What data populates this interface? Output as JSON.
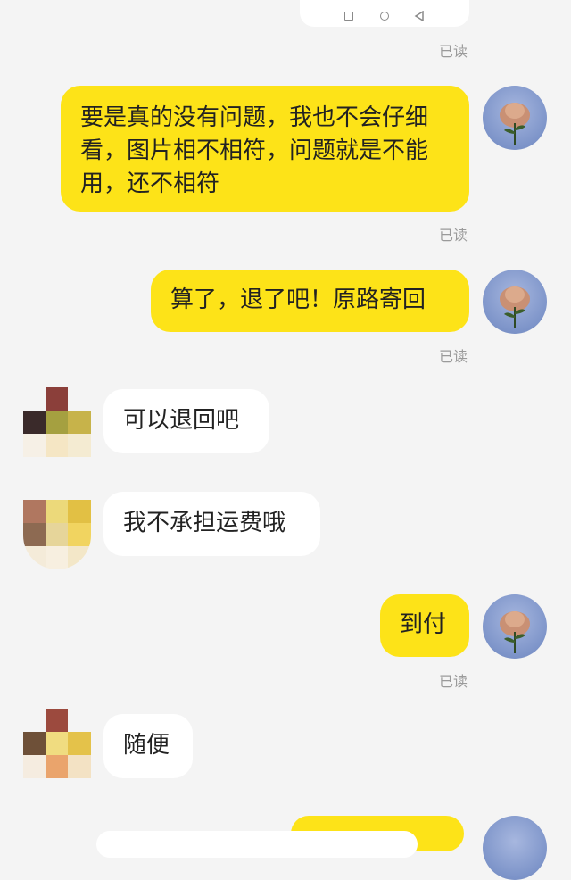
{
  "read_label": "已读",
  "messages": [
    {
      "from": "me",
      "text": "要是真的没有问题，我也不会仔细看，图片相不相符，问题就是不能用，还不相符"
    },
    {
      "from": "me",
      "text": "算了，退了吧！原路寄回"
    },
    {
      "from": "them",
      "text": "可以退回吧"
    },
    {
      "from": "them",
      "text": "我不承担运费哦"
    },
    {
      "from": "me",
      "text": "到付"
    },
    {
      "from": "them",
      "text": "随便"
    }
  ],
  "colors": {
    "my_bubble": "#fde318",
    "their_bubble": "#ffffff",
    "background": "#f4f4f4",
    "read_text": "#9a9a9a"
  },
  "icons": [
    "square-icon",
    "circle-icon",
    "back-triangle-icon"
  ]
}
